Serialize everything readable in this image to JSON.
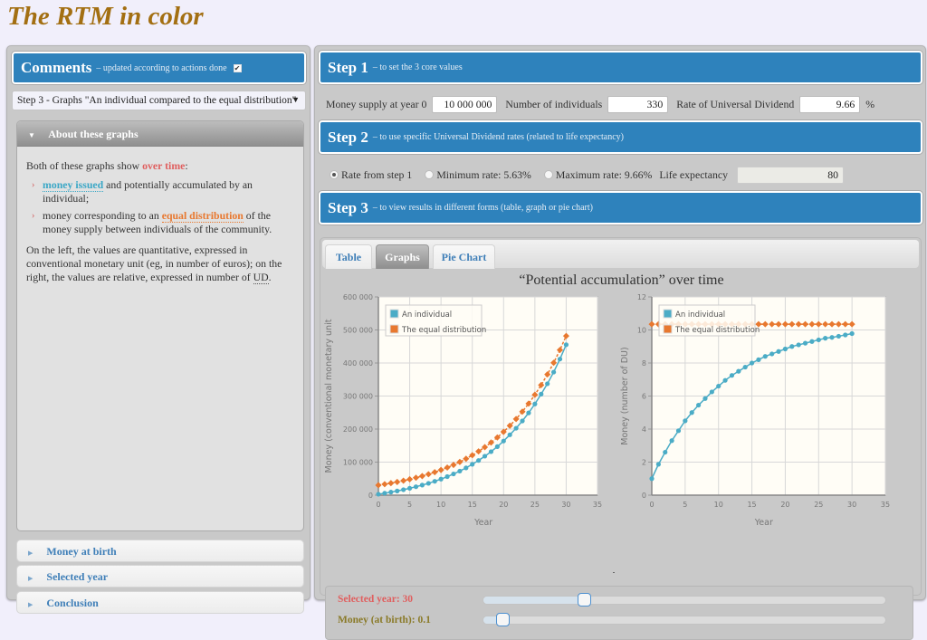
{
  "page": {
    "title": "The RTM in color"
  },
  "comments": {
    "title": "Comments",
    "subtitle": "– updated according to actions done",
    "checkbox_checked": true,
    "select_value": "Step 3 - Graphs \"An individual compared to the equal distribution\"",
    "open_section": {
      "title": "About these graphs",
      "intro_prefix": "Both of these graphs show ",
      "intro_highlight": "over time",
      "intro_suffix": ":",
      "bullets": [
        {
          "highlight": "money issued",
          "text": " and potentially accumulated by an individual;"
        },
        {
          "prefix": "money corresponding to an ",
          "highlight": "equal distribution",
          "text": " of the money supply between individuals of the community."
        }
      ],
      "paragraph_text": "On the left, the values are quantitative, expressed in conventional monetary unit (eg, in number of euros); on the right, the values are relative, expressed in number of ",
      "paragraph_abbr": "UD",
      "paragraph_end": "."
    },
    "closed_sections": [
      "Money at birth",
      "Selected year",
      "Conclusion"
    ]
  },
  "step1": {
    "title": "Step 1",
    "subtitle": "– to set the 3 core values",
    "money_supply_label": "Money supply at year 0",
    "money_supply_value": "10 000 000",
    "individuals_label": "Number of individuals",
    "individuals_value": "330",
    "rate_label": "Rate of Universal Dividend",
    "rate_value": "9.66",
    "rate_unit": "%"
  },
  "step2": {
    "title": "Step 2",
    "subtitle": "– to use specific Universal Dividend rates (related to life expectancy)",
    "options": [
      {
        "label": "Rate from step 1",
        "selected": true
      },
      {
        "label": "Minimum rate: 5.63%",
        "selected": false
      },
      {
        "label": "Maximum rate: 9.66%",
        "selected": false
      }
    ],
    "life_expectancy_label": "Life expectancy",
    "life_expectancy_value": "80"
  },
  "step3": {
    "title": "Step 3",
    "subtitle": "– to view results in different forms (table, graph or pie chart)",
    "tabs": [
      {
        "label": "Table",
        "active": false
      },
      {
        "label": "Graphs",
        "active": true
      },
      {
        "label": "Pie Chart",
        "active": false
      }
    ],
    "graphs_title": "“Potential accumulation” over time"
  },
  "colors": {
    "individual": "#4bacc6",
    "equal": "#e8782f",
    "header_blue": "#2e82bc",
    "title_gold": "#a36f12"
  },
  "sliders": {
    "selected_year_label": "Selected year: 30",
    "selected_year_color": "#e05f5f",
    "selected_year_fraction": 0.25,
    "money_at_birth_label": "Money (at birth): 0.1",
    "money_at_birth_color": "#8a7a28",
    "money_at_birth_fraction": 0.05
  },
  "chart_data": [
    {
      "type": "line",
      "title": "",
      "xlabel": "Year",
      "ylabel": "Money (conventional monetary unit",
      "xlim": [
        0,
        35
      ],
      "ylim": [
        0,
        600000
      ],
      "xticks": [
        0,
        5,
        10,
        15,
        20,
        25,
        30,
        35
      ],
      "yticks": [
        0,
        100000,
        200000,
        300000,
        400000,
        500000,
        600000
      ],
      "ytick_labels": [
        "0",
        "100 000",
        "200 000",
        "300 000",
        "400 000",
        "500 000",
        "600 000"
      ],
      "grid": true,
      "legend": "top-left",
      "x": [
        0,
        1,
        2,
        3,
        4,
        5,
        6,
        7,
        8,
        9,
        10,
        11,
        12,
        13,
        14,
        15,
        16,
        17,
        18,
        19,
        20,
        21,
        22,
        23,
        24,
        25,
        26,
        27,
        28,
        29,
        30
      ],
      "series": [
        {
          "name": "An individual",
          "color": "#4bacc6",
          "values": [
            2930,
            6000,
            9150,
            12740,
            16510,
            20890,
            25460,
            30430,
            35820,
            41960,
            48590,
            56110,
            64220,
            72810,
            82510,
            93400,
            105000,
            117930,
            131640,
            146860,
            163850,
            182710,
            202600,
            224610,
            248980,
            275970,
            305840,
            337170,
            372400,
            411810,
            455280
          ]
        },
        {
          "name": "The equal distribution",
          "color": "#e8782f",
          "values": [
            30303,
            33230,
            36440,
            39960,
            43820,
            48050,
            52700,
            57790,
            63370,
            69490,
            76200,
            83560,
            91630,
            100480,
            110190,
            120830,
            132500,
            145300,
            159340,
            174730,
            191610,
            210120,
            230420,
            252680,
            277090,
            303860,
            333210,
            365400,
            400700,
            439410,
            481850
          ]
        }
      ]
    },
    {
      "type": "line",
      "title": "",
      "xlabel": "Year",
      "ylabel": "Money (number of DU)",
      "xlim": [
        0,
        35
      ],
      "ylim": [
        0,
        12
      ],
      "xticks": [
        0,
        5,
        10,
        15,
        20,
        25,
        30,
        35
      ],
      "yticks": [
        0,
        2,
        4,
        6,
        8,
        10,
        12
      ],
      "ytick_labels": [
        "0",
        "2",
        "4",
        "6",
        "8",
        "10",
        "12"
      ],
      "grid": true,
      "legend": "top-left",
      "x": [
        0,
        1,
        2,
        3,
        4,
        5,
        6,
        7,
        8,
        9,
        10,
        11,
        12,
        13,
        14,
        15,
        16,
        17,
        18,
        19,
        20,
        21,
        22,
        23,
        24,
        25,
        26,
        27,
        28,
        29,
        30
      ],
      "series": [
        {
          "name": "An individual",
          "color": "#4bacc6",
          "values": [
            1.0,
            1.87,
            2.6,
            3.3,
            3.9,
            4.5,
            5.0,
            5.45,
            5.85,
            6.25,
            6.6,
            6.95,
            7.25,
            7.5,
            7.75,
            8.0,
            8.2,
            8.4,
            8.55,
            8.7,
            8.85,
            9.0,
            9.1,
            9.2,
            9.3,
            9.4,
            9.5,
            9.55,
            9.62,
            9.7,
            9.78
          ]
        },
        {
          "name": "The equal distribution",
          "color": "#e8782f",
          "values": [
            10.35,
            10.35,
            10.35,
            10.35,
            10.35,
            10.35,
            10.35,
            10.35,
            10.35,
            10.35,
            10.35,
            10.35,
            10.35,
            10.35,
            10.35,
            10.35,
            10.35,
            10.35,
            10.35,
            10.35,
            10.35,
            10.35,
            10.35,
            10.35,
            10.35,
            10.35,
            10.35,
            10.35,
            10.35,
            10.35,
            10.35
          ]
        }
      ]
    }
  ]
}
